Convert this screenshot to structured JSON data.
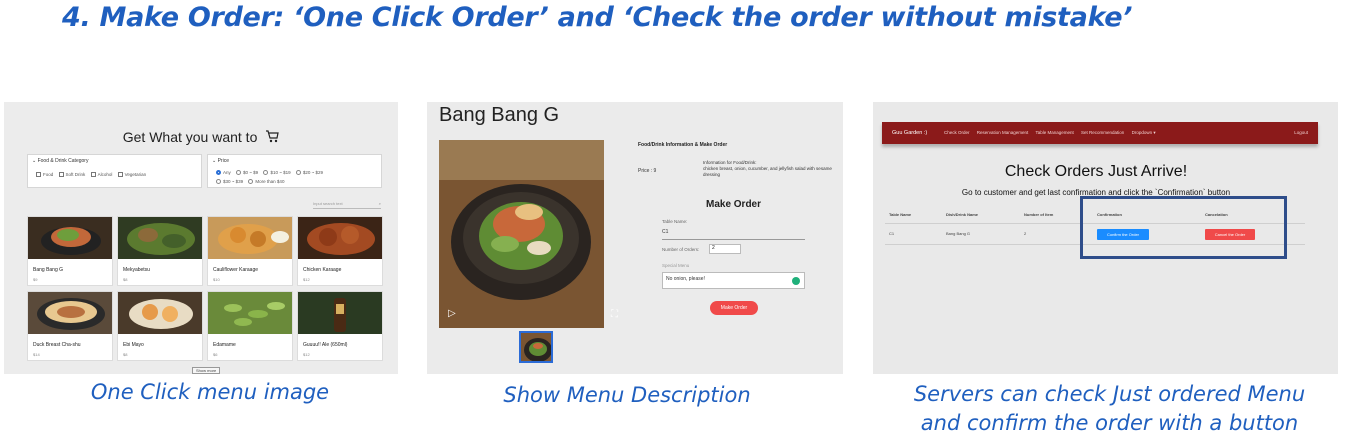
{
  "title": "4. Make Order: ‘One Click Order’ and ‘Check the order without mistake’",
  "panel1": {
    "heading": "Get What you want to",
    "category_filter": {
      "label": "Food & Drink Category",
      "options": [
        "Food",
        "Soft Drink",
        "Alcohol",
        "Vegetarian"
      ]
    },
    "price_filter": {
      "label": "Price",
      "options": [
        "Any",
        "$0 ~ $9",
        "$10 ~ $19",
        "$20 ~ $29",
        "$30 ~ $39",
        "More than $40"
      ],
      "selected": "Any"
    },
    "search_placeholder": "Input search text",
    "items": [
      {
        "name": "Bang Bang G",
        "price": "$9"
      },
      {
        "name": "Mekyabetsu",
        "price": "$8"
      },
      {
        "name": "Cauliflower Karaage",
        "price": "$10"
      },
      {
        "name": "Chicken Karaage",
        "price": "$12"
      },
      {
        "name": "Duck Breast Cha-shu",
        "price": "$14"
      },
      {
        "name": "Ebi Mayo",
        "price": "$8"
      },
      {
        "name": "Edamame",
        "price": "$6"
      },
      {
        "name": "Guuuu!! Ale (650ml)",
        "price": "$12"
      }
    ],
    "show_more": "Show more",
    "caption": "One Click menu image"
  },
  "panel2": {
    "title": "Bang Bang G",
    "info_heading": "Food/Drink Information & Make Order",
    "price_label": "Price : 9",
    "info_label": "Information for Food/Drink:",
    "info_text": "chicken breast, onion, cucumber, and jellyfish salad with sesame dressing",
    "make_order": "Make Order",
    "table_label": "Table Name:",
    "table_value": "C1",
    "orders_label": "Number of Orders:",
    "orders_value": "2",
    "special_label": "Special Menu",
    "special_value": "No onion, please!",
    "button": "Make Order",
    "caption": "Show Menu Description"
  },
  "panel3": {
    "nav": {
      "brand": "Guu Garden :)",
      "links": [
        "Check Order",
        "Reservation Management",
        "Table Management",
        "Set Recommendation",
        "Dropdown ▾"
      ],
      "logout": "Logout"
    },
    "heading": "Check Orders Just Arrive!",
    "sub": "Go to customer and get last confirmation and click the `Confirmation` button",
    "columns": [
      "Table Name",
      "Dish/Drink Name",
      "Number of Item",
      "Confirmation",
      "Cancelation"
    ],
    "row": {
      "table": "C1",
      "dish": "Bang Bang G",
      "count": "2",
      "confirm": "Confirm the Order",
      "cancel": "Cancel the Order"
    },
    "caption_line1": "Servers can check Just ordered Menu",
    "caption_line2": "and confirm the order with a button"
  }
}
